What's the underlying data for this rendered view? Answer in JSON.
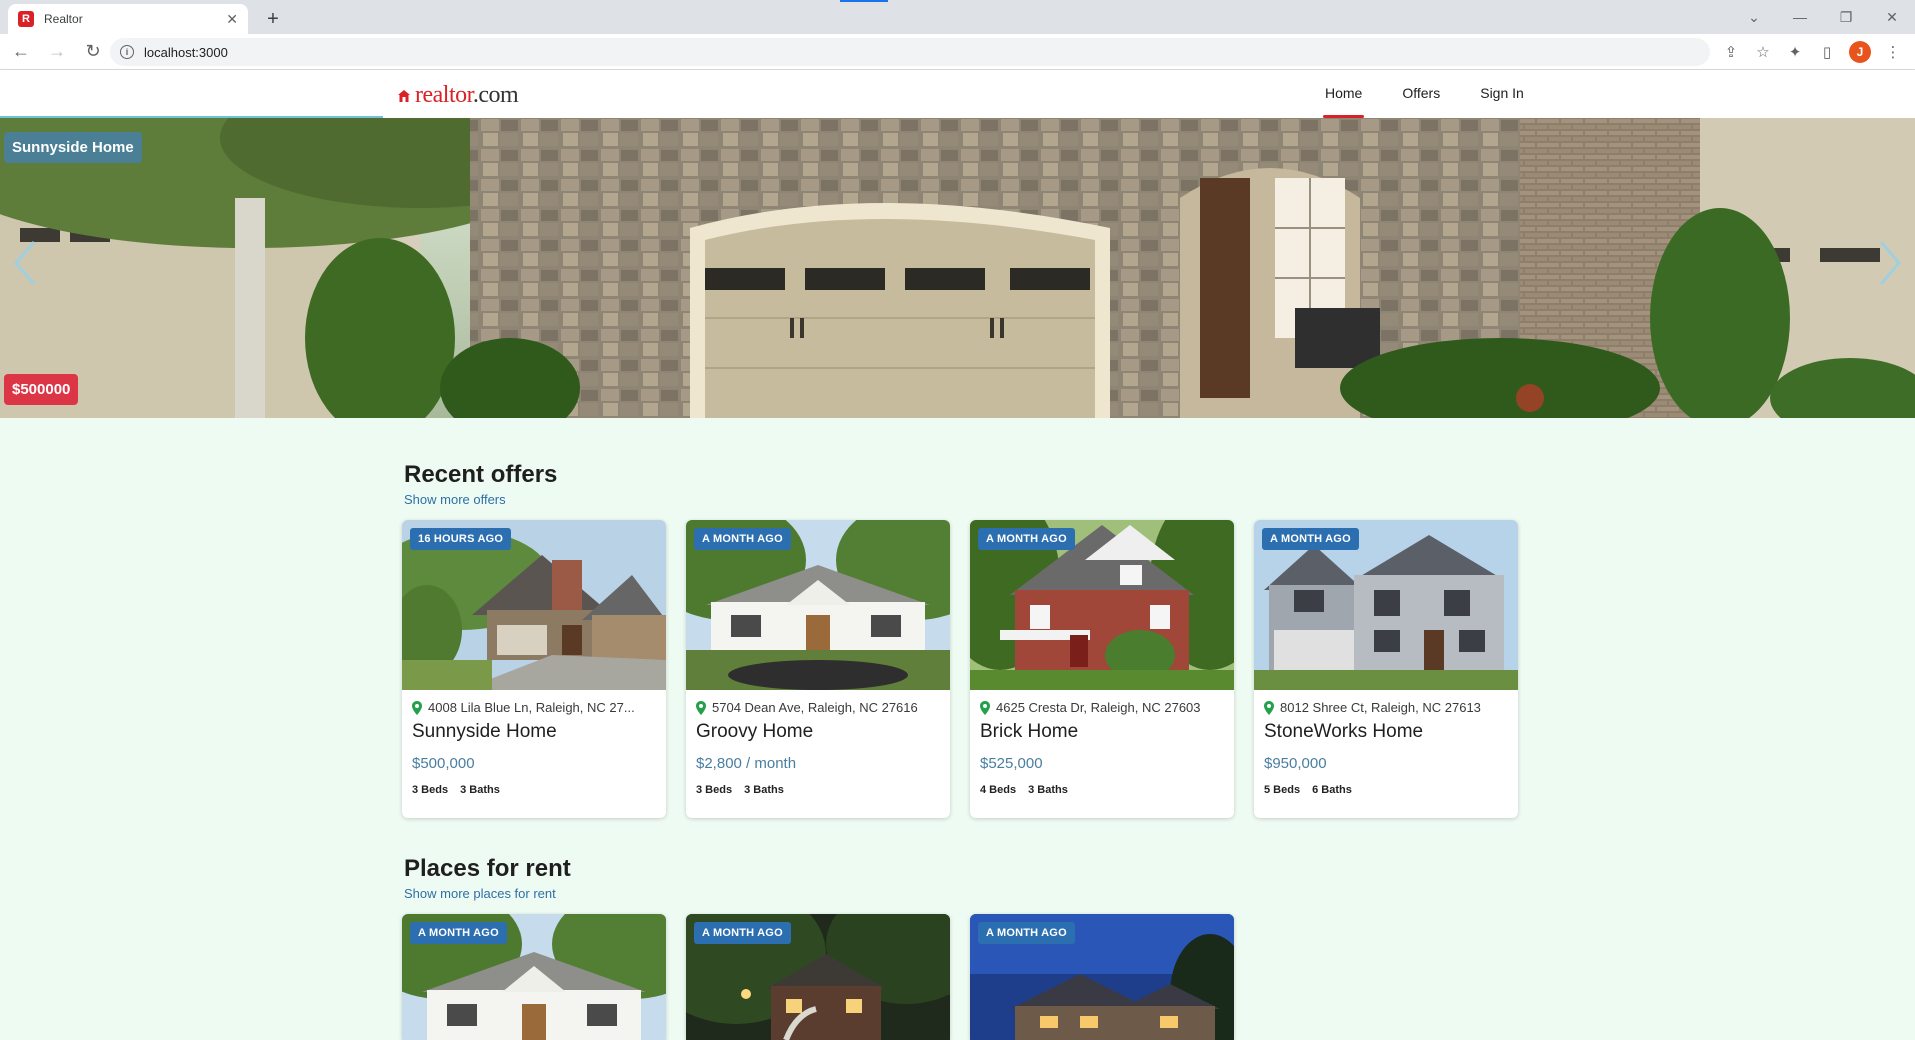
{
  "browser": {
    "tab_title": "Realtor",
    "tab_favicon": "R",
    "url": "localhost:3000",
    "profile_initial": "J"
  },
  "site": {
    "logo_text": "realtor",
    "logo_suffix": ".com",
    "nav": [
      "Home",
      "Offers",
      "Sign In"
    ],
    "active_nav": "Home"
  },
  "hero": {
    "title": "Sunnyside Home",
    "price": "$500000"
  },
  "recent_offers": {
    "title": "Recent offers",
    "link": "Show more offers",
    "cards": [
      {
        "badge": "16 HOURS AGO",
        "address": "4008 Lila Blue Ln, Raleigh, NC 27...",
        "name": "Sunnyside Home",
        "price": "$500,000",
        "beds": "3 Beds",
        "baths": "3 Baths"
      },
      {
        "badge": "A MONTH AGO",
        "address": "5704 Dean Ave, Raleigh, NC 27616",
        "name": "Groovy Home",
        "price": "$2,800 / month",
        "beds": "3 Beds",
        "baths": "3 Baths"
      },
      {
        "badge": "A MONTH AGO",
        "address": "4625 Cresta Dr, Raleigh, NC 27603",
        "name": "Brick Home",
        "price": "$525,000",
        "beds": "4 Beds",
        "baths": "3 Baths"
      },
      {
        "badge": "A MONTH AGO",
        "address": "8012 Shree Ct, Raleigh, NC 27613",
        "name": "StoneWorks Home",
        "price": "$950,000",
        "beds": "5 Beds",
        "baths": "6 Baths"
      }
    ]
  },
  "places_for_rent": {
    "title": "Places for rent",
    "link": "Show more places for rent",
    "cards": [
      {
        "badge": "A MONTH AGO"
      },
      {
        "badge": "A MONTH AGO"
      },
      {
        "badge": "A MONTH AGO"
      }
    ]
  },
  "colors": {
    "brand_red": "#d92228",
    "badge_blue": "#2c6fb0",
    "price_blue": "#4a7ea0",
    "page_bg": "#eefbf2"
  },
  "icons": [
    "back-icon",
    "forward-icon",
    "reload-icon",
    "info-icon",
    "share-icon",
    "star-icon",
    "extensions-icon",
    "sidepanel-icon",
    "menu-icon",
    "location-pin-icon",
    "chevron-left-icon",
    "chevron-right-icon"
  ]
}
